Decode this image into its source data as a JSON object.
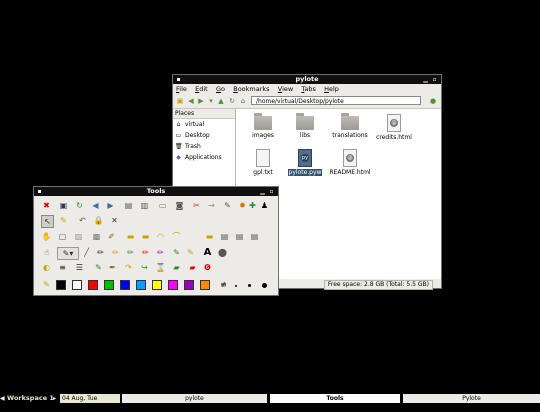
{
  "filemanager": {
    "title": "pylote",
    "menu": [
      "File",
      "Edit",
      "Go",
      "Bookmarks",
      "View",
      "Tabs",
      "Help"
    ],
    "location": "/home/virtual/Desktop/pylote",
    "places_header": "Places",
    "places": [
      {
        "label": "virtual",
        "icon": "home-icon"
      },
      {
        "label": "Desktop",
        "icon": "desktop-icon"
      },
      {
        "label": "Trash",
        "icon": "trash-icon"
      },
      {
        "label": "Applications",
        "icon": "applications-icon"
      }
    ],
    "files": [
      {
        "name": "images",
        "kind": "folder"
      },
      {
        "name": "libs",
        "kind": "folder"
      },
      {
        "name": "translations",
        "kind": "folder"
      },
      {
        "name": "credits.html",
        "kind": "html"
      },
      {
        "name": "gpl.txt",
        "kind": "text"
      },
      {
        "name": "pylote.pyw",
        "kind": "python",
        "selected": true
      },
      {
        "name": "README.html",
        "kind": "html"
      }
    ],
    "status": "Free space: 2.8 GB (Total: 5.5 GB)"
  },
  "tools_window": {
    "title": "Tools",
    "palette_colors": [
      "#000000",
      "#ffffff",
      "#ff0000",
      "#00c000",
      "#0000ff",
      "#00a0ff",
      "#ffff00",
      "#ff00ff",
      "#9a00c0",
      "#ff8800"
    ]
  },
  "taskbar": {
    "workspace": "Workspace 1",
    "clock": "04 Aug, Tue 23:49:42",
    "tasks": [
      "pylote",
      "Tools",
      "Pylote"
    ]
  }
}
